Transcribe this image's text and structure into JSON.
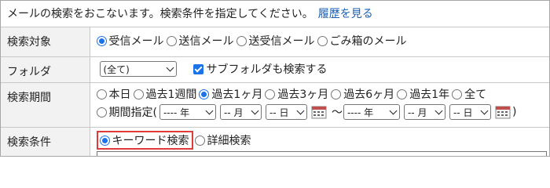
{
  "intro": {
    "text": "メールの検索をおこないます。検索条件を指定してください。",
    "history_link": "履歴を見る"
  },
  "rows": {
    "target": {
      "label": "検索対象",
      "options": [
        "受信メール",
        "送信メール",
        "送受信メール",
        "ごみ箱のメール"
      ],
      "selected": "受信メール"
    },
    "folder": {
      "label": "フォルダ",
      "select_value": "(全て)",
      "subfolder_checkbox_label": "サブフォルダも検索する",
      "subfolder_checked": true
    },
    "period": {
      "label": "検索期間",
      "options": [
        "本日",
        "過去1週間",
        "過去1ヶ月",
        "過去3ヶ月",
        "過去6ヶ月",
        "過去1年",
        "全て"
      ],
      "selected": "過去1ヶ月",
      "custom_label": "期間指定(",
      "from_year": "---- 年",
      "from_month": "-- 月",
      "from_day": "-- 日",
      "tilde": "〜",
      "to_year": "---- 年",
      "to_month": "-- 月",
      "to_day": "-- 日",
      "close_paren": ")"
    },
    "condition": {
      "label": "検索条件",
      "options": [
        "キーワード検索",
        "詳細検索"
      ],
      "selected": "キーワード検索"
    }
  },
  "colors": {
    "accent": "#1a73e8",
    "link": "#1a5fb4",
    "highlight_border": "#e03a3a",
    "label_bg": "#f2f2f2"
  },
  "icons": {
    "calendar": "calendar-icon",
    "dropdown": "chevron-down-icon"
  }
}
